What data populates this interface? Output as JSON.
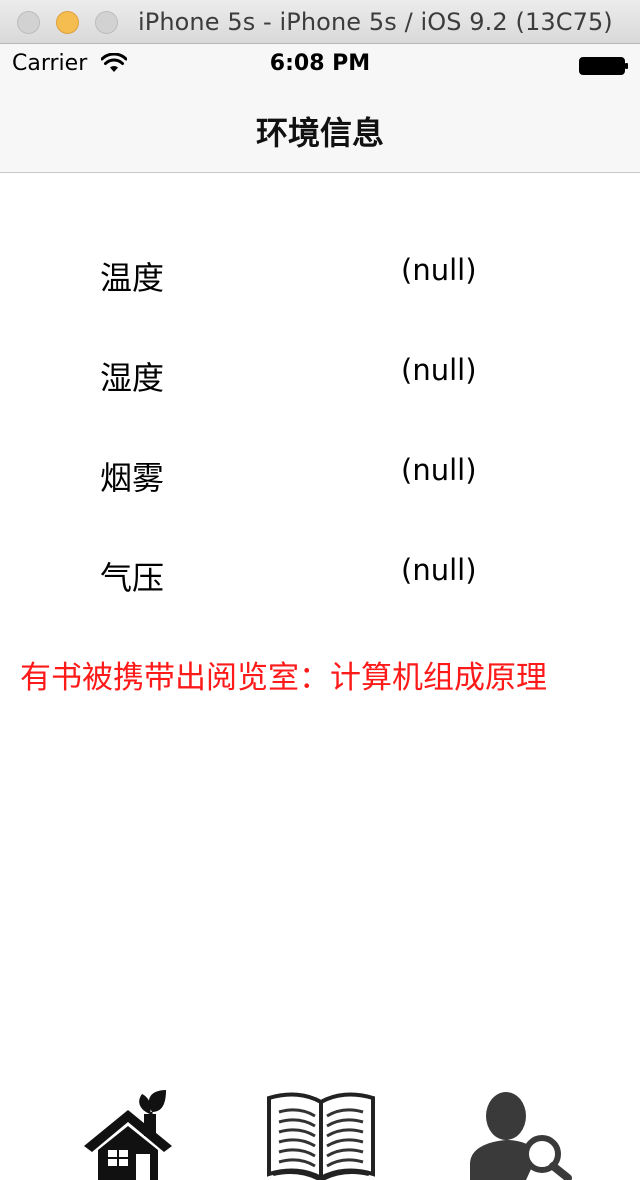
{
  "window": {
    "title": "iPhone 5s - iPhone 5s / iOS 9.2 (13C75)"
  },
  "status_bar": {
    "carrier": "Carrier",
    "time": "6:08 PM",
    "wifi_icon": "wifi-icon",
    "battery_icon": "battery-full-icon"
  },
  "nav": {
    "title": "环境信息"
  },
  "readings": [
    {
      "label": "温度",
      "value": "(null)"
    },
    {
      "label": "湿度",
      "value": "(null)"
    },
    {
      "label": "烟雾",
      "value": "(null)"
    },
    {
      "label": "气压",
      "value": "(null)"
    }
  ],
  "alert": {
    "text": "有书被携带出阅览室：计算机组成原理",
    "color": "#ff1a1a"
  },
  "tab_bar": {
    "tabs": [
      {
        "icon": "eco-home-icon"
      },
      {
        "icon": "open-book-icon"
      },
      {
        "icon": "user-search-icon"
      }
    ]
  }
}
